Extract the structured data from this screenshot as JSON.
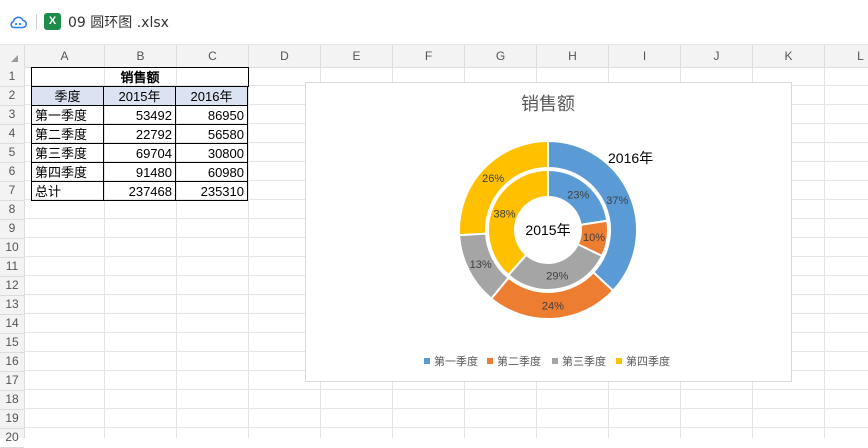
{
  "app": {
    "file_name": "09 圆环图 .xlsx",
    "excel_icon_letter": "X"
  },
  "columns": [
    "A",
    "B",
    "C",
    "D",
    "E",
    "F",
    "G",
    "H",
    "I",
    "J",
    "K",
    "L"
  ],
  "rows": [
    "1",
    "2",
    "3",
    "4",
    "5",
    "6",
    "7",
    "8",
    "9",
    "10",
    "11",
    "12",
    "13",
    "14",
    "15",
    "16",
    "17",
    "18",
    "19",
    "20"
  ],
  "sheet": {
    "title": "销售额",
    "header": [
      "季度",
      "2015年",
      "2016年"
    ],
    "data": [
      [
        "第一季度",
        "53492",
        "86950"
      ],
      [
        "第二季度",
        "22792",
        "56580"
      ],
      [
        "第三季度",
        "69704",
        "30800"
      ],
      [
        "第四季度",
        "91480",
        "60980"
      ],
      [
        "总计",
        "237468",
        "235310"
      ]
    ]
  },
  "colors": {
    "q1": "#5b9bd5",
    "q2": "#ed7d31",
    "q3": "#a5a5a5",
    "q4": "#ffc000",
    "excel_green": "#1e8d4a",
    "cloud_blue": "#2e7cf6"
  },
  "chart_data": {
    "type": "doughnut",
    "title": "销售额",
    "categories": [
      "第一季度",
      "第二季度",
      "第三季度",
      "第四季度"
    ],
    "series": [
      {
        "name": "2015年",
        "values": [
          53492,
          22792,
          69704,
          91480
        ],
        "labels": [
          "23%",
          "10%",
          "29%",
          "38%"
        ]
      },
      {
        "name": "2016年",
        "values": [
          86950,
          56580,
          30800,
          60980
        ],
        "labels": [
          "37%",
          "24%",
          "13%",
          "26%"
        ]
      }
    ],
    "center_label": "2015年",
    "outer_label": "2016年",
    "legend": [
      "第一季度",
      "第二季度",
      "第三季度",
      "第四季度"
    ],
    "legend_position": "bottom"
  }
}
